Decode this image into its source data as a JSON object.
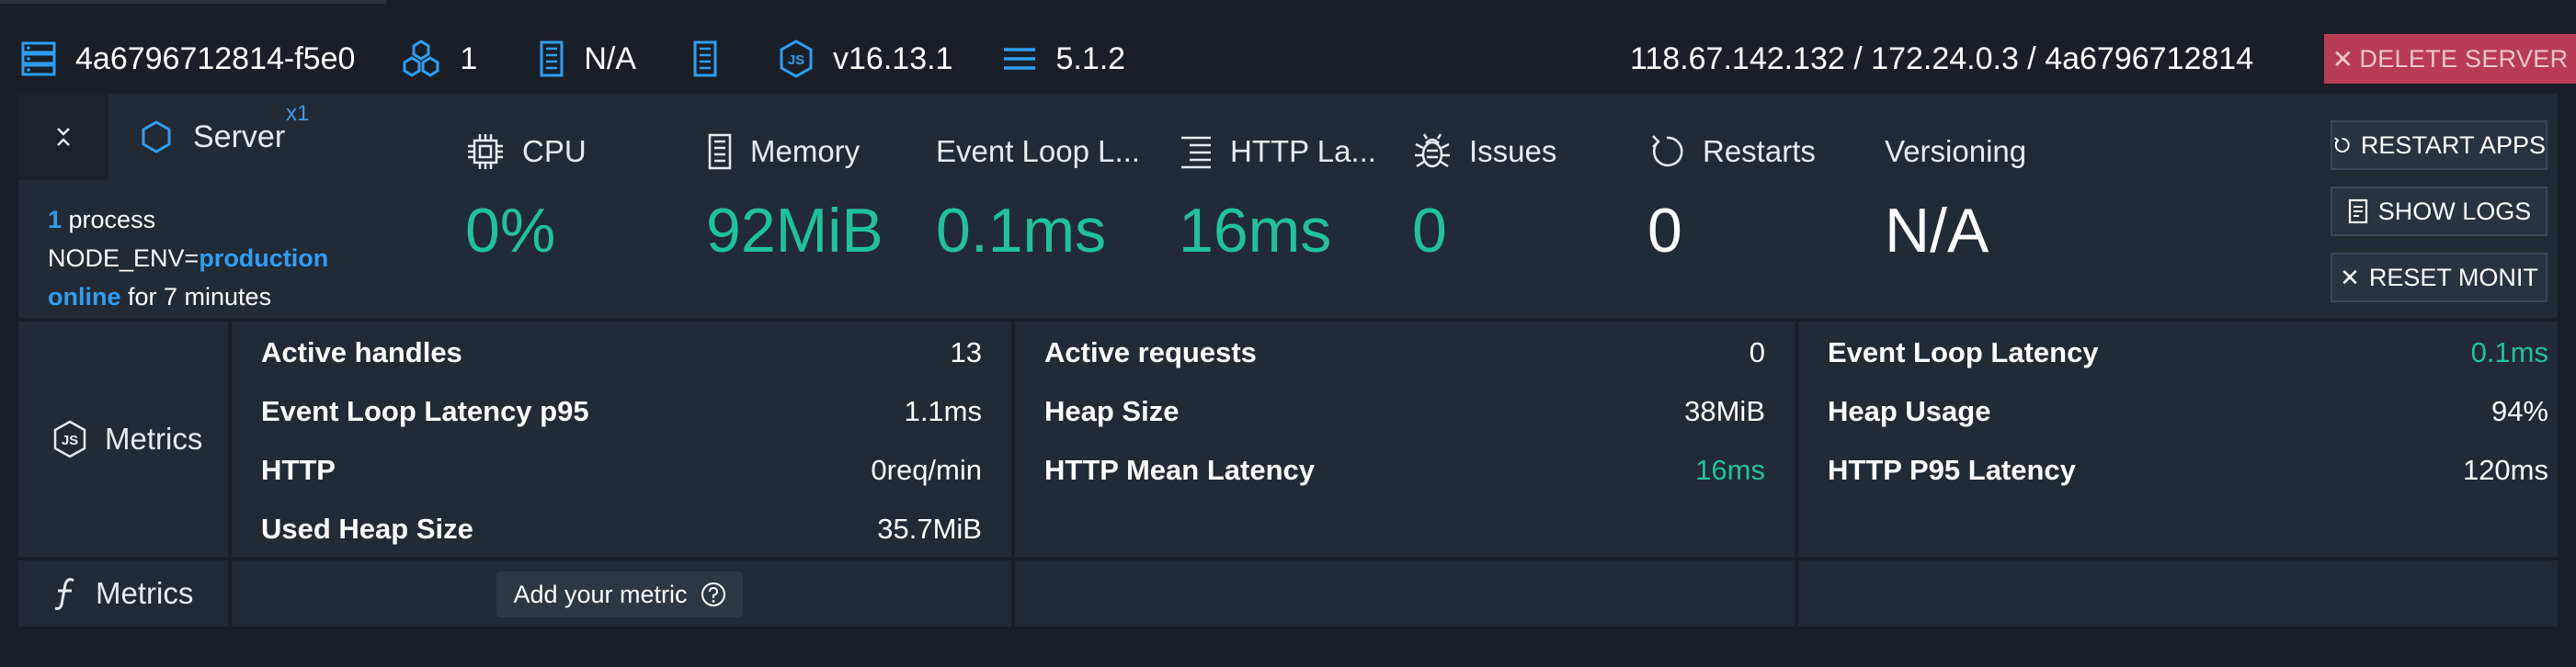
{
  "header": {
    "server_id": "4a6796712814-f5e0",
    "process_count": "1",
    "memory_info": "N/A",
    "node_version": "v16.13.1",
    "pm2_version": "5.1.2",
    "addresses": "118.67.142.132 / 172.24.0.3 / 4a6796712814",
    "delete_label": "DELETE SERVER"
  },
  "server": {
    "tab_label": "Server",
    "tab_count": "x1",
    "process_num": "1",
    "process_word": " process",
    "env_key": "NODE_ENV=",
    "env_value": "production",
    "status": "online",
    "uptime": " for 7 minutes"
  },
  "stats": [
    {
      "label": "CPU",
      "value": "0%",
      "icon": "cpu-icon"
    },
    {
      "label": "Memory",
      "value": "92MiB",
      "icon": "memory-icon"
    },
    {
      "label": "Event Loop L...",
      "value": "0.1ms",
      "icon": ""
    },
    {
      "label": "HTTP La...",
      "value": "16ms",
      "icon": "list-icon"
    },
    {
      "label": "Issues",
      "value": "0",
      "icon": "bug-icon"
    },
    {
      "label": "Restarts",
      "value": "0",
      "icon": "restart-icon"
    },
    {
      "label": "Versioning",
      "value": "N/A",
      "icon": ""
    }
  ],
  "actions": {
    "restart": "RESTART APPS",
    "logs": "SHOW LOGS",
    "reset": "RESET MONIT"
  },
  "metrics": {
    "label": "Metrics",
    "col1": [
      {
        "k": "Active handles",
        "v": "13"
      },
      {
        "k": "Event Loop Latency p95",
        "v": "1.1ms"
      },
      {
        "k": "HTTP",
        "v": "0req/min"
      },
      {
        "k": "Used Heap Size",
        "v": "35.7MiB"
      }
    ],
    "col2": [
      {
        "k": "Active requests",
        "v": "0"
      },
      {
        "k": "Heap Size",
        "v": "38MiB"
      },
      {
        "k": "HTTP Mean Latency",
        "v": "16ms"
      }
    ],
    "col3": [
      {
        "k": "Event Loop Latency",
        "v": "0.1ms"
      },
      {
        "k": "Heap Usage",
        "v": "94%"
      },
      {
        "k": "HTTP P95 Latency",
        "v": "120ms"
      }
    ]
  },
  "custom_metrics": {
    "label": "Metrics",
    "add_label": "Add your metric"
  },
  "colors": {
    "accent": "#2f9ef2",
    "good": "#1fc29b",
    "danger": "#b83b55",
    "background": "#1a1f27",
    "panel": "#222a35"
  }
}
